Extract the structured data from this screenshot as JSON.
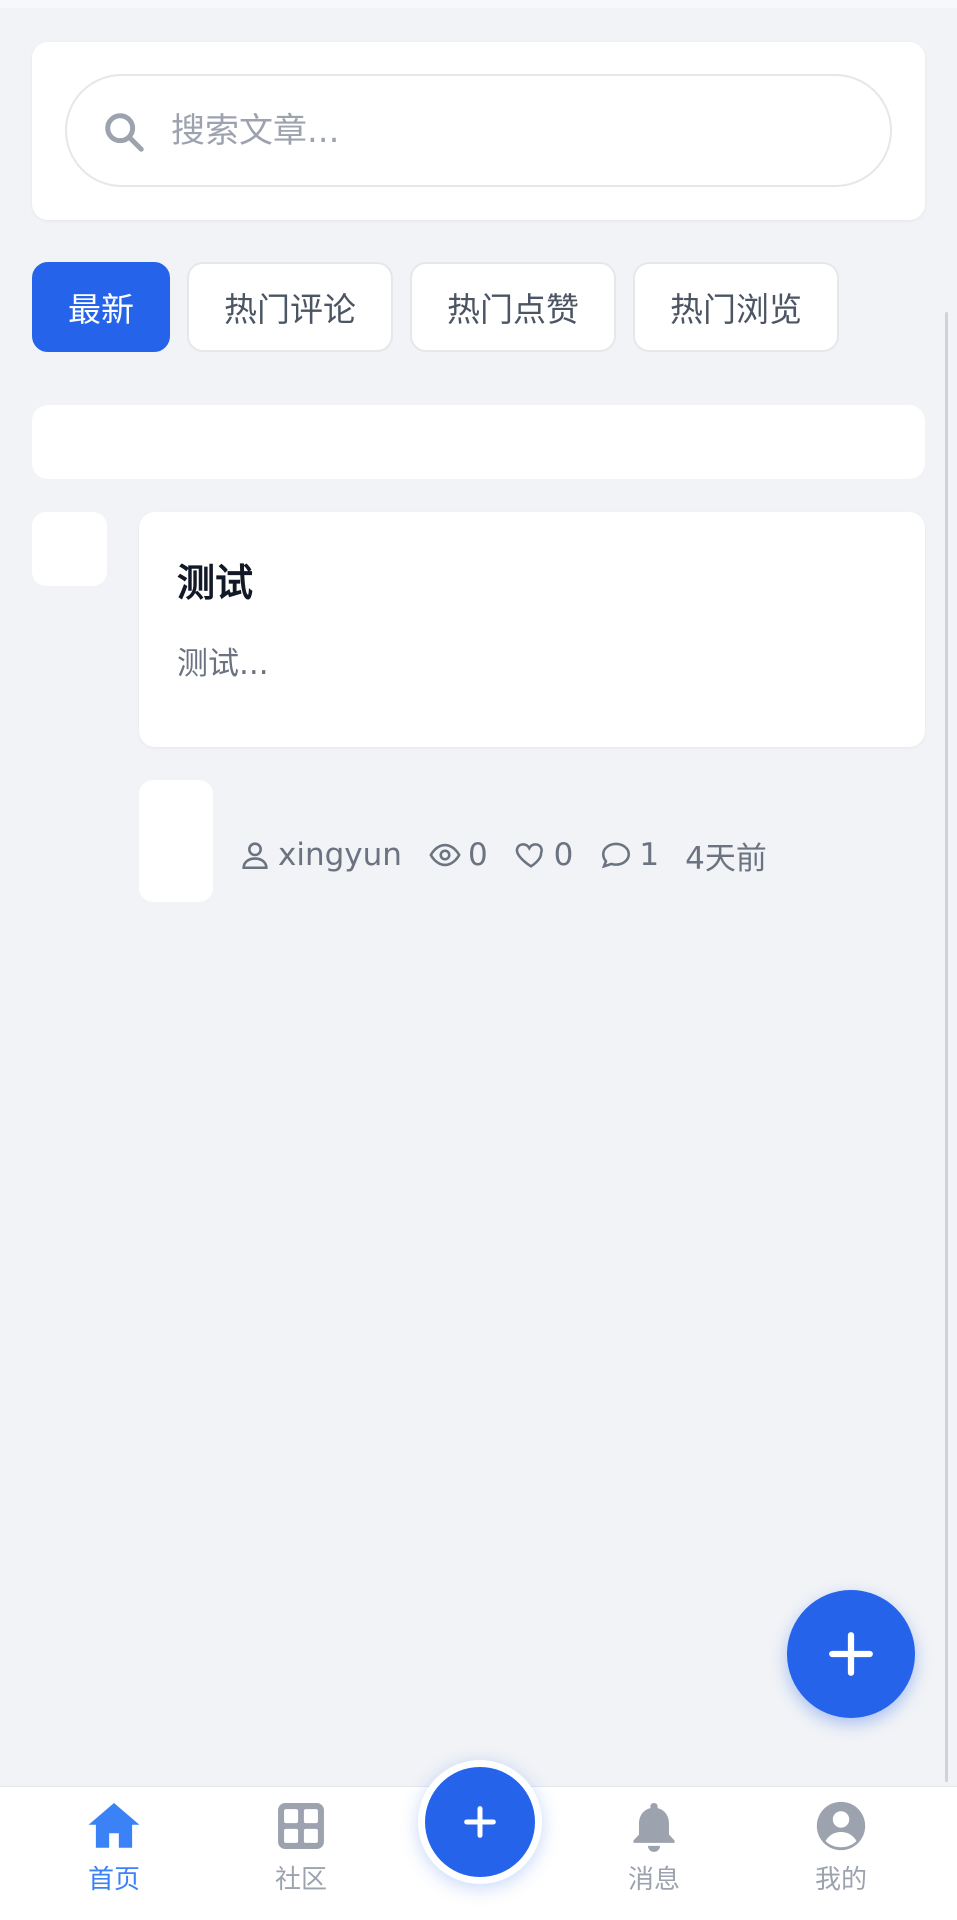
{
  "search": {
    "placeholder": "搜索文章...",
    "icon": "search-icon"
  },
  "tabs": [
    {
      "label": "最新",
      "active": true
    },
    {
      "label": "热门评论",
      "active": false
    },
    {
      "label": "热门点赞",
      "active": false
    },
    {
      "label": "热门浏览",
      "active": false
    }
  ],
  "article": {
    "title": "测试",
    "excerpt": "测试...",
    "author": "xingyun",
    "views": "0",
    "likes": "0",
    "comments": "1",
    "time": "4天前"
  },
  "fab": {
    "icon": "plus-icon"
  },
  "bottom_nav": {
    "items": [
      {
        "label": "首页",
        "icon": "home-icon",
        "active": true
      },
      {
        "label": "社区",
        "icon": "grid-icon",
        "active": false
      },
      {
        "label": "消息",
        "icon": "bell-icon",
        "active": false
      },
      {
        "label": "我的",
        "icon": "user-circle-icon",
        "active": false
      }
    ],
    "center_icon": "plus-icon"
  },
  "colors": {
    "accent": "#2563eb",
    "background": "#f1f3f6",
    "muted_text": "#6b7280",
    "nav_inactive": "#9ca3af"
  }
}
